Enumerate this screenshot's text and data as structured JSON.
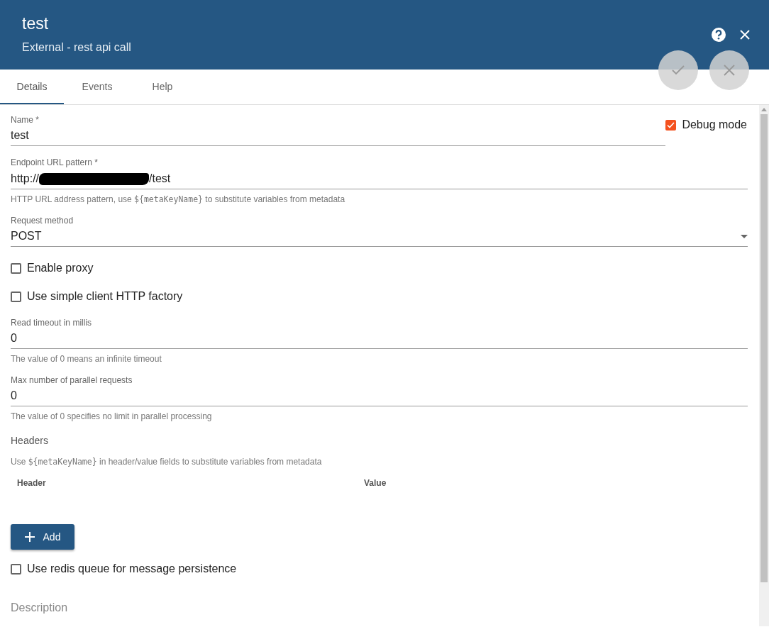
{
  "header": {
    "title": "test",
    "subtitle": "External - rest api call"
  },
  "tabs": [
    {
      "label": "Details",
      "selected": true
    },
    {
      "label": "Events",
      "selected": false
    },
    {
      "label": "Help",
      "selected": false
    }
  ],
  "action_buttons": [
    {
      "kind": "save",
      "disabled": true
    },
    {
      "kind": "cancel",
      "disabled": true
    }
  ],
  "name_field": {
    "label": "Name *",
    "value": "test"
  },
  "debug_mode": {
    "label": "Debug mode",
    "checked": true
  },
  "fields": [
    {
      "kind": "text",
      "label": "Endpoint URL pattern *",
      "value_start": "http://",
      "redacted": true,
      "value_end": "/test",
      "hint": {
        "before": "HTTP URL address pattern, use ",
        "code": "${metaKeyName}",
        "after": " to substitute variables from metadata"
      }
    },
    {
      "kind": "select",
      "label": "Request method",
      "value_start": "POST"
    },
    {
      "kind": "checkbox",
      "label": "Enable proxy",
      "checked": false
    },
    {
      "kind": "checkbox",
      "label": "Use simple client HTTP factory",
      "checked": false
    },
    {
      "kind": "text",
      "label": "Read timeout in millis",
      "value_start": "0",
      "hint": {
        "before": "The value of 0 means an infinite timeout"
      }
    },
    {
      "kind": "text",
      "label": "Max number of parallel requests",
      "value_start": "0",
      "hint": {
        "before": "The value of 0 specifies no limit in parallel processing"
      }
    }
  ],
  "headers": {
    "title": "Headers",
    "hint": {
      "before": "Use ",
      "code": "${metaKeyName}",
      "after": " in header/value fields to substitute variables from metadata"
    },
    "columns": [
      "Header",
      "Value"
    ],
    "add_button": "Add"
  },
  "redis_queue": {
    "label": "Use redis queue for message persistence",
    "checked": false
  },
  "description": {
    "placeholder": "Description"
  }
}
